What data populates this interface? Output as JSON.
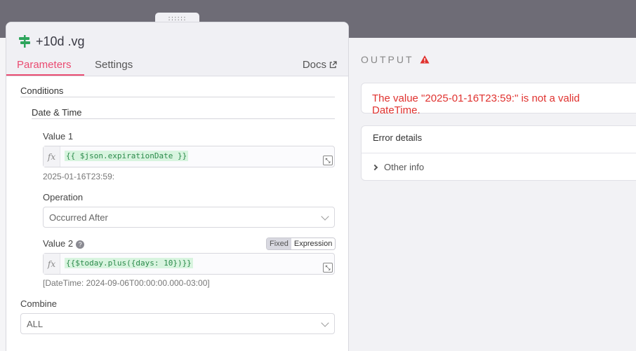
{
  "node": {
    "title": "+10d .vg",
    "drag_glyph": "::::::"
  },
  "tabs": {
    "parameters": "Parameters",
    "settings": "Settings",
    "docs": "Docs"
  },
  "conditions": {
    "label": "Conditions",
    "date_time_label": "Date & Time",
    "value1": {
      "label": "Value 1",
      "expression": "{{ $json.expirationDate }}",
      "preview": "2025-01-16T23:59:"
    },
    "operation": {
      "label": "Operation",
      "selected": "Occurred After"
    },
    "value2": {
      "label": "Value 2",
      "mode_fixed": "Fixed",
      "mode_expression": "Expression",
      "expression": "{{$today.plus({days: 10})}}",
      "preview": "[DateTime: 2024-09-06T00:00:00.000-03:00]"
    }
  },
  "combine": {
    "label": "Combine",
    "selected": "ALL"
  },
  "output": {
    "title": "OUTPUT",
    "error_message": "The value \"2025-01-16T23:59:\" is not a valid DateTime.",
    "details_title": "Error details",
    "other_info": "Other info"
  },
  "colors": {
    "accent": "#ea4b71",
    "error": "#e0322f",
    "expression_text": "#2a8a4a",
    "expression_bg": "#d8f4df",
    "node_icon": "#2ea55c"
  }
}
